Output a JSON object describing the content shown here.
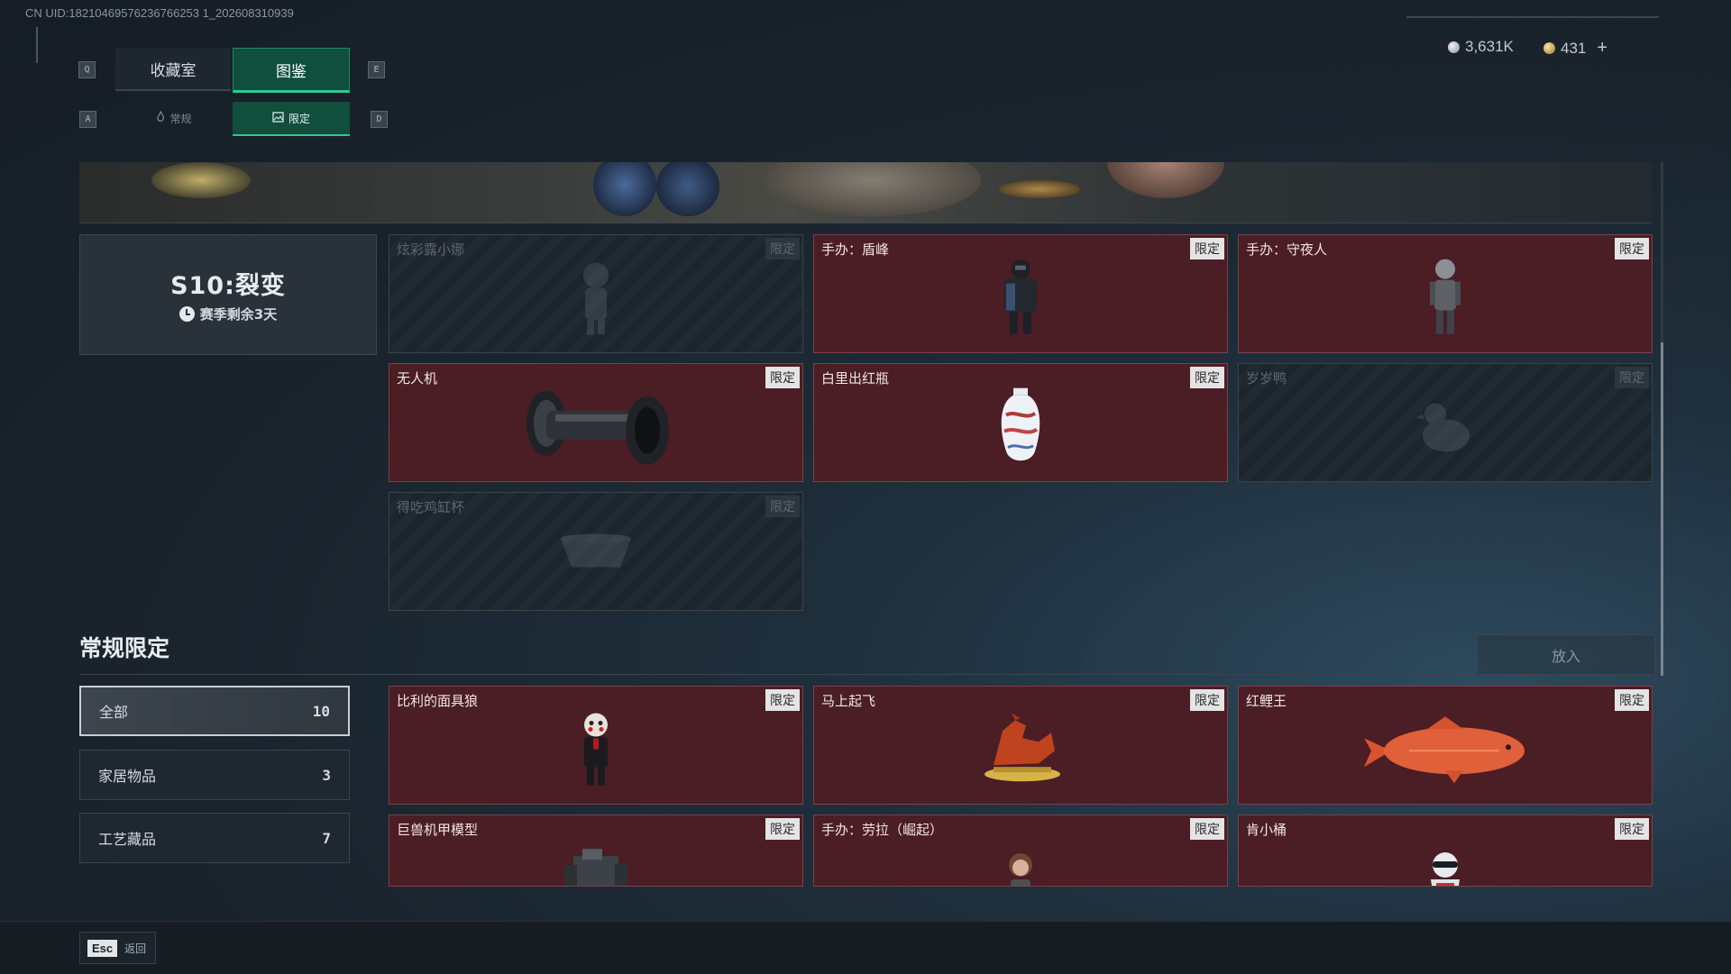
{
  "uid_text": "CN UID:18210469576236766253 1_202608310939",
  "currency": {
    "silver": "3,631K",
    "gold": "431",
    "add_label": "+",
    "silver_icon": "silver-coin-icon",
    "gold_icon": "gold-coin-icon"
  },
  "keys": {
    "q": "Q",
    "e": "E",
    "a": "A",
    "d": "D"
  },
  "tabs": {
    "collection": "收藏室",
    "catalog": "图鉴"
  },
  "subtabs": {
    "regular": "常规",
    "limited": "限定"
  },
  "season": {
    "name": "S10:裂变",
    "remaining": "赛季剩余3天"
  },
  "tag_label": "限定",
  "season_items": [
    {
      "name": "炫彩露小娜",
      "locked": true
    },
    {
      "name": "手办：盾峰",
      "locked": false
    },
    {
      "name": "手办：守夜人",
      "locked": false
    },
    {
      "name": "无人机",
      "locked": false
    },
    {
      "name": "白里出红瓶",
      "locked": false
    },
    {
      "name": "岁岁鸭",
      "locked": true
    },
    {
      "name": "得吃鸡缸杯",
      "locked": true
    }
  ],
  "section": {
    "title": "常规限定",
    "put_in": "放入"
  },
  "filters": [
    {
      "label": "全部",
      "count": "10",
      "active": true
    },
    {
      "label": "家居物品",
      "count": "3",
      "active": false
    },
    {
      "label": "工艺藏品",
      "count": "7",
      "active": false
    }
  ],
  "regular_items": [
    {
      "name": "比利的面具狼"
    },
    {
      "name": "马上起飞"
    },
    {
      "name": "红鲤王"
    },
    {
      "name": "巨兽机甲模型"
    },
    {
      "name": "手办：劳拉（崛起）"
    },
    {
      "name": "肯小桶"
    }
  ],
  "footer": {
    "esc_key": "Esc",
    "back_label": "返回"
  },
  "colors": {
    "accent": "#2fc98f",
    "owned_card": "#4b1d24",
    "background": "#1a242d"
  }
}
